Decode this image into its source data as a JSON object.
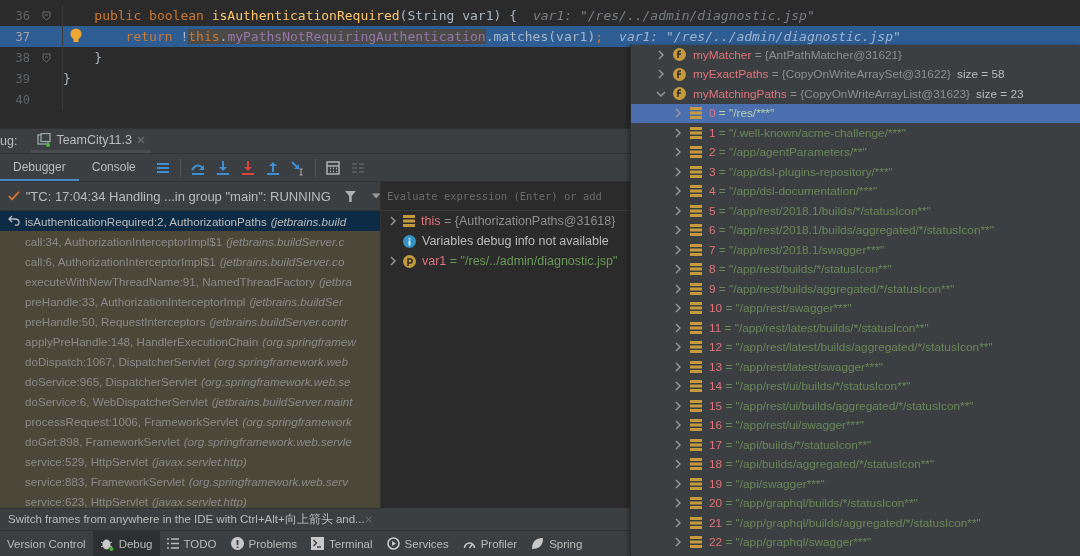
{
  "editor": {
    "lines": [
      {
        "number": "36",
        "current": false,
        "fold": true,
        "tokens": [
          {
            "kind": "keyword",
            "text": "    public boolean ",
            "marked": false
          },
          {
            "kind": "method",
            "text": "isAuthenticationRequired",
            "marked": false
          },
          {
            "kind": "plain",
            "text": "(String var1) {",
            "marked": false
          }
        ],
        "hint": "var1: \"/res/../admin/diagnostic.jsp\""
      },
      {
        "number": "37",
        "current": true,
        "fold": false,
        "tokens": [
          {
            "kind": "keyword",
            "text": "        return ",
            "marked": false
          },
          {
            "kind": "plain",
            "text": "!",
            "marked": false
          },
          {
            "kind": "keyword",
            "text": "this",
            "marked": true
          },
          {
            "kind": "plain",
            "text": ".",
            "marked": true
          },
          {
            "kind": "field",
            "text": "myPathsNotRequiringAuthentication",
            "marked": true
          },
          {
            "kind": "plain",
            "text": ".matches(var1)",
            "marked": false
          },
          {
            "kind": "keyword",
            "text": ";",
            "marked": false
          }
        ],
        "hint": "var1: \"/res/../admin/diagnostic.jsp\""
      },
      {
        "number": "38",
        "current": false,
        "fold": true,
        "tokens": [
          {
            "kind": "plain",
            "text": "    }",
            "marked": false
          }
        ]
      },
      {
        "number": "39",
        "current": false,
        "fold": false,
        "tokens": [
          {
            "kind": "plain",
            "text": "}",
            "marked": false
          }
        ]
      },
      {
        "number": "40",
        "current": false,
        "fold": false
      }
    ]
  },
  "debug": {
    "label": "ug:",
    "sessions": [
      {
        "label": "TeamCity11.3",
        "selected": true
      }
    ],
    "tabs": [
      {
        "label": "Debugger",
        "selected": true
      },
      {
        "label": "Console",
        "selected": false
      }
    ],
    "thread": "\"TC: 17:04:34 Handling ...in group \"main\": RUNNING",
    "frames": [
      {
        "method": "isAuthenticationRequired:2, AuthorizationPaths",
        "package": "(jetbrains.build",
        "selected": true
      },
      {
        "method": "call:34, AuthorizationInterceptorImpl$1",
        "package": "(jetbrains.buildServer.c",
        "selected": false
      },
      {
        "method": "call:6, AuthorizationInterceptorImpl$1",
        "package": "(jetbrains.buildServer.co",
        "selected": false
      },
      {
        "method": "executeWithNewThreadName:91, NamedThreadFactory",
        "package": "(jetbra",
        "selected": false
      },
      {
        "method": "preHandle:33, AuthorizationInterceptorImpl",
        "package": "(jetbrains.buildSer",
        "selected": false
      },
      {
        "method": "preHandle:50, RequestInterceptors",
        "package": "(jetbrains.buildServer.contr",
        "selected": false
      },
      {
        "method": "applyPreHandle:148, HandlerExecutionChain",
        "package": "(org.springframew",
        "selected": false
      },
      {
        "method": "doDispatch:1067, DispatcherServlet",
        "package": "(org.springframework.web",
        "selected": false
      },
      {
        "method": "doService:965, DispatcherServlet",
        "package": "(org.springframework.web.se",
        "selected": false
      },
      {
        "method": "doService:6, WebDispatcherServlet",
        "package": "(jetbrains.buildServer.maint",
        "selected": false
      },
      {
        "method": "processRequest:1006, FrameworkServlet",
        "package": "(org.springframework",
        "selected": false
      },
      {
        "method": "doGet:898, FrameworkServlet",
        "package": "(org.springframework.web.servle",
        "selected": false
      },
      {
        "method": "service:529, HttpServlet",
        "package": "(javax.servlet.http)",
        "selected": false
      },
      {
        "method": "service:883, FrameworkServlet",
        "package": "(org.springframework.web.serv",
        "selected": false
      },
      {
        "method": "service:623, HttpServlet",
        "package": "(javax.servlet.http)",
        "selected": false
      }
    ],
    "evaluate": {
      "placeholder": "Evaluate expression (Enter) or add"
    },
    "variables": [
      {
        "kind": "object",
        "name": "this",
        "value": "= {AuthorizationPaths@31618}"
      },
      {
        "kind": "info",
        "text": "Variables debug info not available"
      },
      {
        "kind": "param",
        "name": "var1",
        "value": "= \"/res/../admin/diagnostic.jsp\""
      }
    ],
    "tip": "Switch frames from anywhere in the IDE with Ctrl+Alt+向上箭头 and..."
  },
  "tool_tabs": [
    {
      "kind": "vcs",
      "label": "Version Control",
      "selected": false
    },
    {
      "kind": "debug",
      "label": "Debug",
      "selected": true
    },
    {
      "kind": "todo",
      "label": "TODO",
      "selected": false
    },
    {
      "kind": "problems",
      "label": "Problems",
      "selected": false
    },
    {
      "kind": "terminal",
      "label": "Terminal",
      "selected": false
    },
    {
      "kind": "services",
      "label": "Services",
      "selected": false
    },
    {
      "kind": "profiler",
      "label": "Profiler",
      "selected": false
    },
    {
      "kind": "spring",
      "label": "Spring",
      "selected": false
    }
  ],
  "popup": {
    "fields": [
      {
        "name": "myMatcher",
        "value": "= {AntPathMatcher@31621}",
        "expanded": false
      },
      {
        "name": "myExactPaths",
        "value": "= {CopyOnWriteArraySet@31622}",
        "size": "size = 58",
        "expanded": false
      },
      {
        "name": "myMatchingPaths",
        "value": "= {CopyOnWriteArrayList@31623}",
        "size": "size = 23",
        "expanded": true,
        "children": [
          {
            "index": "0",
            "value": "= \"/res/***\"",
            "selected": true
          },
          {
            "index": "1",
            "value": "= \"/.well-known/acme-challenge/***\"",
            "selected": false
          },
          {
            "index": "2",
            "value": "= \"/app/agentParameters/**\"",
            "selected": false
          },
          {
            "index": "3",
            "value": "= \"/app/dsl-plugins-repository/***\"",
            "selected": false
          },
          {
            "index": "4",
            "value": "= \"/app/dsl-documentation/***\"",
            "selected": false
          },
          {
            "index": "5",
            "value": "= \"/app/rest/2018.1/builds/*/statusIcon**\"",
            "selected": false
          },
          {
            "index": "6",
            "value": "= \"/app/rest/2018.1/builds/aggregated/*/statusIcon**\"",
            "selected": false
          },
          {
            "index": "7",
            "value": "= \"/app/rest/2018.1/swagger***\"",
            "selected": false
          },
          {
            "index": "8",
            "value": "= \"/app/rest/builds/*/statusIcon**\"",
            "selected": false
          },
          {
            "index": "9",
            "value": "= \"/app/rest/builds/aggregated/*/statusIcon**\"",
            "selected": false
          },
          {
            "index": "10",
            "value": "= \"/app/rest/swagger***\"",
            "selected": false
          },
          {
            "index": "11",
            "value": "= \"/app/rest/latest/builds/*/statusIcon**\"",
            "selected": false
          },
          {
            "index": "12",
            "value": "= \"/app/rest/latest/builds/aggregated/*/statusIcon**\"",
            "selected": false
          },
          {
            "index": "13",
            "value": "= \"/app/rest/latest/swagger***\"",
            "selected": false
          },
          {
            "index": "14",
            "value": "= \"/app/rest/ui/builds/*/statusIcon**\"",
            "selected": false
          },
          {
            "index": "15",
            "value": "= \"/app/rest/ui/builds/aggregated/*/statusIcon**\"",
            "selected": false
          },
          {
            "index": "16",
            "value": "= \"/app/rest/ui/swagger***\"",
            "selected": false
          },
          {
            "index": "17",
            "value": "= \"/api/builds/*/statusIcon**\"",
            "selected": false
          },
          {
            "index": "18",
            "value": "= \"/api/builds/aggregated/*/statusIcon**\"",
            "selected": false
          },
          {
            "index": "19",
            "value": "= \"/api/swagger***\"",
            "selected": false
          },
          {
            "index": "20",
            "value": "= \"/app/graphql/builds/*/statusIcon**\"",
            "selected": false
          },
          {
            "index": "21",
            "value": "= \"/app/graphql/builds/aggregated/*/statusIcon**\"",
            "selected": false
          },
          {
            "index": "22",
            "value": "= \"/app/graphql/swagger***\"",
            "selected": false
          }
        ]
      }
    ]
  }
}
